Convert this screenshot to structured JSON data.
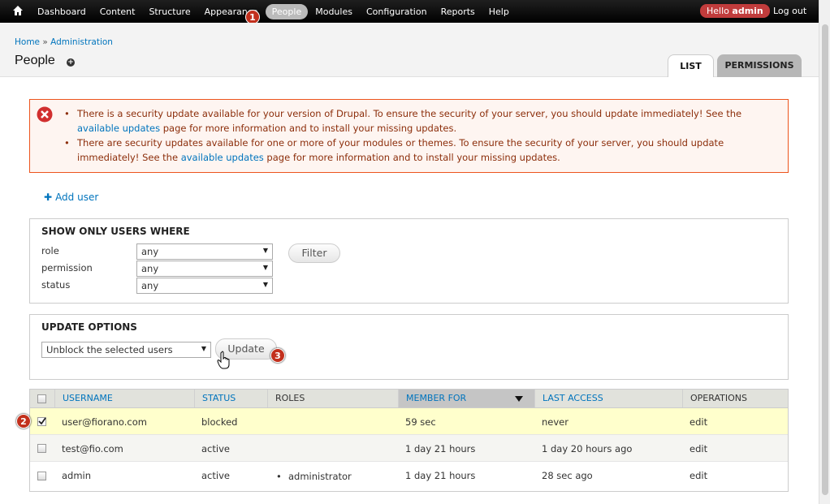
{
  "toolbar": {
    "menu": [
      "Dashboard",
      "Content",
      "Structure",
      "Appearance",
      "People",
      "Modules",
      "Configuration",
      "Reports",
      "Help"
    ],
    "hello_prefix": "Hello ",
    "hello_user": "admin",
    "logout": "Log out"
  },
  "breadcrumb": {
    "home": "Home",
    "sep": " » ",
    "admin": "Administration"
  },
  "page_title": "People",
  "tabs": {
    "list": "LIST",
    "permissions": "PERMISSIONS"
  },
  "messages": {
    "items": [
      {
        "before": "There is a security update available for your version of Drupal. To ensure the security of your server, you should update immediately! See the ",
        "link": "available updates",
        "after": " page for more information and to install your missing updates."
      },
      {
        "before": "There are security updates available for one or more of your modules or themes. To ensure the security of your server, you should update immediately! See the ",
        "link": "available updates",
        "after": " page for more information and to install your missing updates."
      }
    ]
  },
  "add_user": "Add user",
  "filters": {
    "legend": "SHOW ONLY USERS WHERE",
    "role_label": "role",
    "role_value": "any",
    "permission_label": "permission",
    "permission_value": "any",
    "status_label": "status",
    "status_value": "any",
    "filter_button": "Filter"
  },
  "update_options": {
    "legend": "UPDATE OPTIONS",
    "select_value": "Unblock the selected users",
    "update_button": "Update"
  },
  "table": {
    "headers": {
      "username": "USERNAME",
      "status": "STATUS",
      "roles": "ROLES",
      "member_for": "MEMBER FOR",
      "last_access": "LAST ACCESS",
      "operations": "OPERATIONS"
    },
    "rows": [
      {
        "username": "user@fiorano.com",
        "status": "blocked",
        "roles": "",
        "member_for": "59 sec",
        "last_access": "never",
        "op": "edit",
        "checked": true
      },
      {
        "username": "test@fio.com",
        "status": "active",
        "roles": "",
        "member_for": "1 day 21 hours",
        "last_access": "1 day 20 hours ago",
        "op": "edit",
        "checked": false
      },
      {
        "username": "admin",
        "status": "active",
        "roles": "administrator",
        "member_for": "1 day 21 hours",
        "last_access": "28 sec ago",
        "op": "edit",
        "checked": false
      }
    ]
  },
  "markers": {
    "m1": "1",
    "m2": "2",
    "m3": "3"
  },
  "colors": {
    "link": "#0074bd",
    "error_border": "#ed541d",
    "error_text": "#8c2e0b",
    "highlight_row": "#ffffcc",
    "marker": "#c2301d"
  }
}
